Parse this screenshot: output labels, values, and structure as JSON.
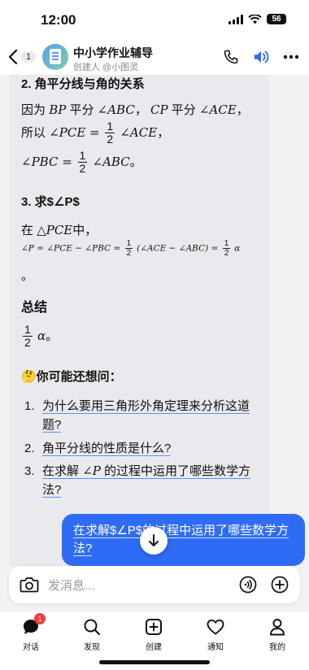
{
  "status": {
    "time": "12:00",
    "battery": "56"
  },
  "header": {
    "back_badge": "1",
    "title": "中小学作业辅导",
    "subtitle": "创建人 @小图灵"
  },
  "answer": {
    "section2_title": "2. 角平分线与角的关系",
    "line1_a": "因为",
    "line1_b": "BP",
    "line1_c": " 平分 ",
    "line1_d": "∠ABC",
    "line1_e": "，",
    "line1_f": "CP",
    "line1_g": " 平分 ",
    "line1_h": "∠ACE",
    "line1_i": "，",
    "line2_a": "所以",
    "line2_b": "∠PCE = ",
    "frac_num": "1",
    "frac_den": "2",
    "line2_c": "∠ACE",
    "line2_d": "，",
    "line3_a": "∠PBC = ",
    "line3_b": "∠ABC",
    "line3_c": "。",
    "section3_title": "3. 求$∠P$",
    "line4_a": "在",
    "line4_b": "△PCE",
    "line4_c": "中，",
    "line5_a": "∠P = ∠PCE − ∠PBC = ",
    "line5_b": "(∠ACE − ∠ABC) = ",
    "line5_c": "α",
    "line6": "。",
    "summary_title": "总结",
    "summary_alpha": "α",
    "summary_end": "。"
  },
  "followups": {
    "title": "🤔你可能还想问：",
    "items": [
      {
        "num": "1.",
        "text": "为什么要用三角形外角定理来分析这道题?"
      },
      {
        "num": "2.",
        "text": "角平分线的性质是什么?"
      },
      {
        "num": "3.",
        "text_a": "在求解",
        "text_b": "∠P",
        "text_c": "的过程中运用了哪些数学方法?"
      }
    ]
  },
  "user_message": "在求解$∠P$的过程中运用了哪些数学方法?",
  "input": {
    "placeholder": "发消息..."
  },
  "tabs": [
    {
      "label": "对话",
      "badge": "1"
    },
    {
      "label": "发现"
    },
    {
      "label": "创建"
    },
    {
      "label": "通知"
    },
    {
      "label": "我的"
    }
  ]
}
